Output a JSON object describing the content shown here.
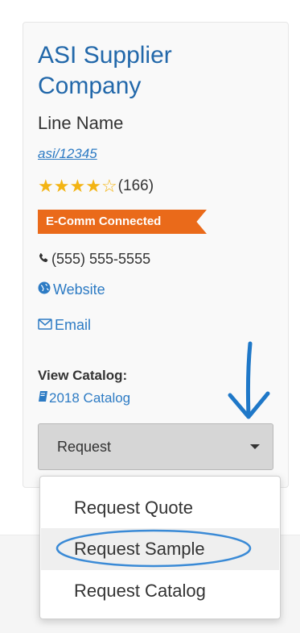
{
  "supplier": {
    "name": "ASI Supplier Company",
    "line_name": "Line Name",
    "asi_number": "asi/12345",
    "rating": {
      "stars_filled": 4,
      "stars_total": 5,
      "count": "(166)"
    },
    "badge": "E-Comm Connected",
    "phone": "(555) 555-5555",
    "website_label": "Website",
    "email_label": "Email"
  },
  "catalog": {
    "label": "View Catalog:",
    "link": "2018 Catalog"
  },
  "request": {
    "button_label": "Request",
    "menu": [
      {
        "label": "Request Quote"
      },
      {
        "label": "Request Sample"
      },
      {
        "label": "Request Catalog"
      }
    ]
  },
  "colors": {
    "brand_blue": "#2268aa",
    "link_blue": "#2d7bc4",
    "badge_orange": "#ea6a1a",
    "star_gold": "#f3b414"
  },
  "icons": [
    "phone-icon",
    "globe-icon",
    "envelope-icon",
    "book-icon",
    "caret-down-icon",
    "annotation-arrow-icon"
  ]
}
